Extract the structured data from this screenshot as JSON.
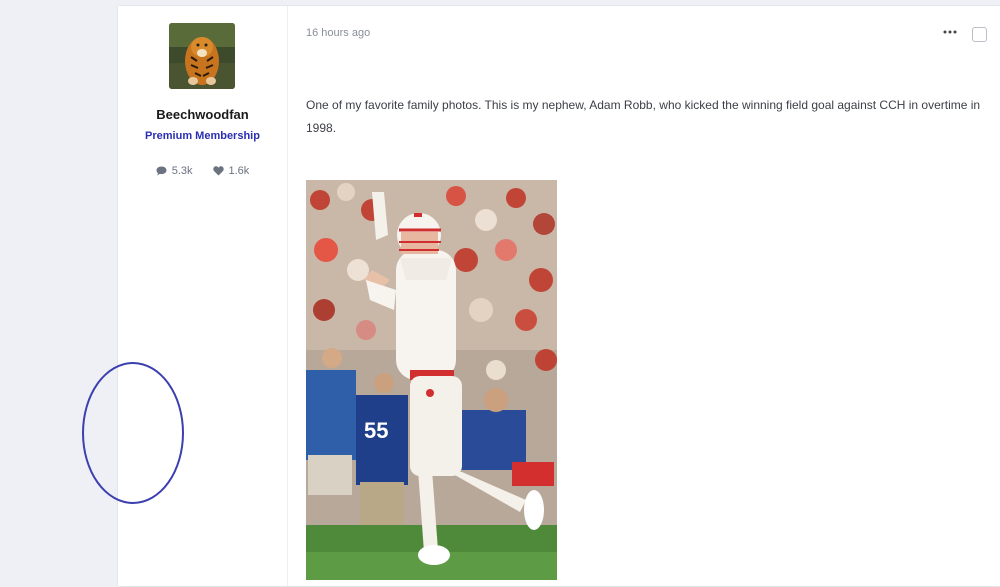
{
  "author": {
    "name": "Beechwoodfan",
    "membership": "Premium Membership",
    "membership_color": "#2b2db3",
    "posts_count": "5.3k",
    "reputation_count": "1.6k",
    "avatar_icon": "tiger-avatar"
  },
  "post": {
    "timestamp": "16 hours ago",
    "more_icon": "ellipsis-icon",
    "body": "One of my favorite family photos. This is my nephew, Adam Robb, who kicked the winning field goal against CCH in overtime in 1998."
  },
  "photo": {
    "jersey_number": "55"
  },
  "annotation": {
    "shape": "ellipse",
    "color": "#3c3fae"
  }
}
